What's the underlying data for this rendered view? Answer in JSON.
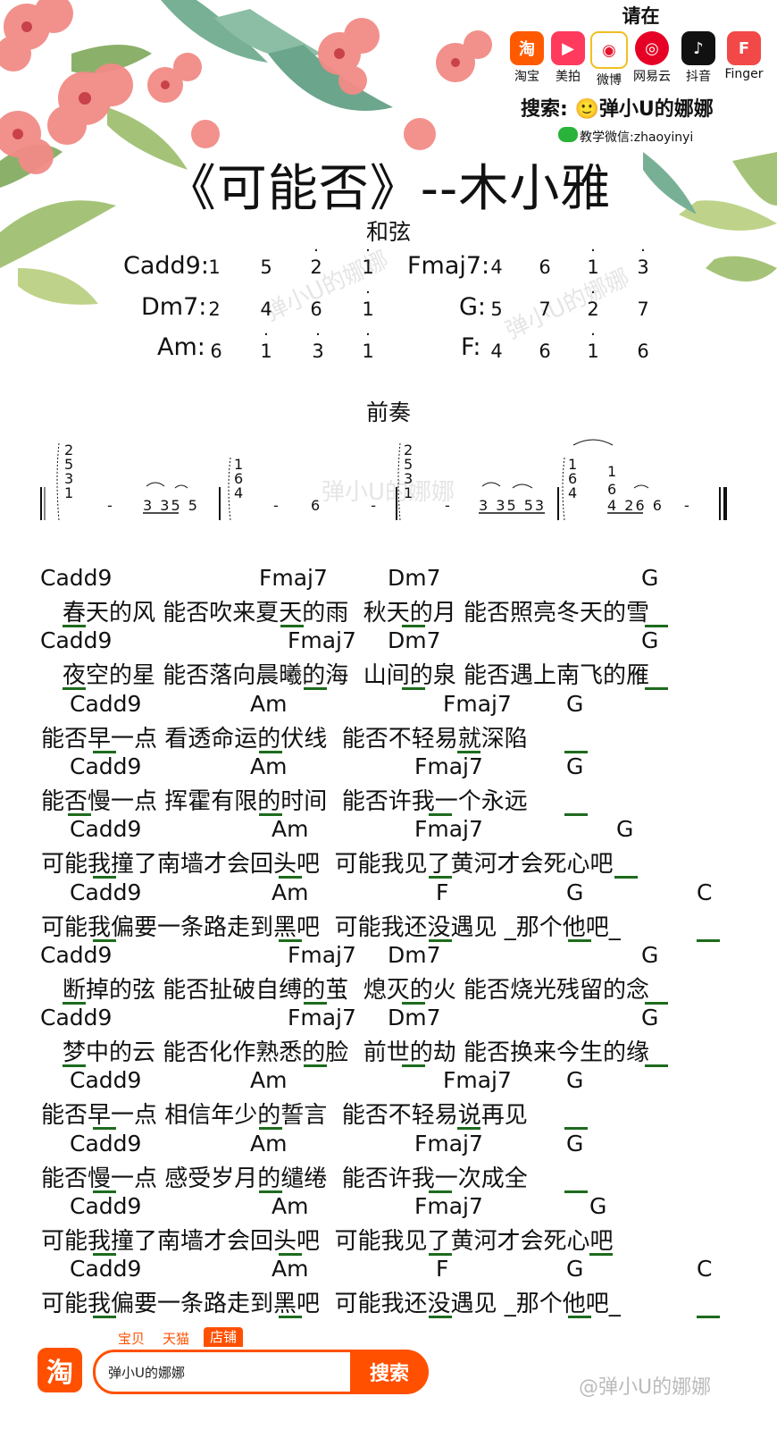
{
  "promo": {
    "title": "请在",
    "apps": [
      {
        "icon": "taobao-icon",
        "glyph": "淘",
        "color": "#ff5a00",
        "label": "淘宝"
      },
      {
        "icon": "meipai-icon",
        "glyph": "▶",
        "color": "#ff3a5c",
        "label": "美拍"
      },
      {
        "icon": "weibo-icon",
        "glyph": "◉",
        "color": "#e6162d",
        "label": "微博"
      },
      {
        "icon": "netease-music-icon",
        "glyph": "◎",
        "color": "#e60026",
        "label": "网易云"
      },
      {
        "icon": "douyin-icon",
        "glyph": "♪",
        "color": "#111111",
        "label": "抖音"
      },
      {
        "icon": "finger-icon",
        "glyph": "F",
        "color": "#f24848",
        "label": "Finger"
      }
    ],
    "search_label": "搜索: 🙂弹小U的娜娜",
    "wechat": "教学微信:zhaoyinyi"
  },
  "title": "《可能否》--木小雅",
  "chords_section_label": "和弦",
  "chord_shapes": [
    {
      "name": "Cadd9:",
      "notes": [
        "1",
        "5",
        "2",
        "1"
      ]
    },
    {
      "name": "Fmaj7:",
      "notes": [
        "4",
        "6",
        "1",
        "3"
      ]
    },
    {
      "name": "Dm7:",
      "notes": [
        "2",
        "4",
        "6",
        "1"
      ]
    },
    {
      "name": "G:",
      "notes": [
        "5",
        "7",
        "2",
        "7"
      ]
    },
    {
      "name": "Am:",
      "notes": [
        "6",
        "1",
        "3",
        "1"
      ]
    },
    {
      "name": "F:",
      "notes": [
        "4",
        "6",
        "1",
        "6"
      ]
    }
  ],
  "intro_label": "前奏",
  "intro": {
    "stack1": [
      "2",
      "5",
      "3",
      "1"
    ],
    "stack2": [
      "1",
      "6",
      "4"
    ],
    "stack3": [
      "2",
      "5",
      "3",
      "1"
    ],
    "stack4": [
      "1",
      "6",
      "4"
    ],
    "m1_rest": "-",
    "m1_notes": "3 35 5",
    "m2_rest": "-",
    "m2_notes": "6 -",
    "m3_rest": "-",
    "m3_notes": "3 35 53",
    "m4_top": "1",
    "m4_mid": "6",
    "m4_notes": "4 26 6",
    "m4_rest": "-"
  },
  "lines": [
    {
      "chords": [
        "Cadd9",
        "Fmaj7",
        "Dm7",
        "G"
      ],
      "lyric": "春天的风 能否吹来夏天的雨  秋天的月 能否照亮冬天的雪"
    },
    {
      "chords": [
        "Cadd9",
        "Fmaj7",
        "Dm7",
        "G"
      ],
      "lyric": "夜空的星 能否落向晨曦的海  山间的泉 能否遇上南飞的雁"
    },
    {
      "chords": [
        "Cadd9",
        "Am",
        "Fmaj7",
        "G"
      ],
      "lyric": "能否早一点 看透命运的伏线  能否不轻易就深陷"
    },
    {
      "chords": [
        "Cadd9",
        "Am",
        "Fmaj7",
        "G"
      ],
      "lyric": "能否慢一点 挥霍有限的时间  能否许我一个永远"
    },
    {
      "chords": [
        "Cadd9",
        "Am",
        "Fmaj7",
        "G"
      ],
      "lyric": "可能我撞了南墙才会回头吧  可能我见了黄河才会死心吧"
    },
    {
      "chords": [
        "Cadd9",
        "Am",
        "F",
        "G",
        "C"
      ],
      "lyric": "可能我偏要一条路走到黑吧  可能我还没遇见 _那个他吧_"
    },
    {
      "chords": [
        "Cadd9",
        "Fmaj7",
        "Dm7",
        "G"
      ],
      "lyric": "断掉的弦 能否扯破自缚的茧  熄灭的火 能否烧光残留的念"
    },
    {
      "chords": [
        "Cadd9",
        "Fmaj7",
        "Dm7",
        "G"
      ],
      "lyric": "梦中的云 能否化作熟悉的脸  前世的劫 能否换来今生的缘"
    },
    {
      "chords": [
        "Cadd9",
        "Am",
        "Fmaj7",
        "G"
      ],
      "lyric": "能否早一点 相信年少的誓言  能否不轻易说再见"
    },
    {
      "chords": [
        "Cadd9",
        "Am",
        "Fmaj7",
        "G"
      ],
      "lyric": "能否慢一点 感受岁月的缱绻  能否许我一次成全"
    },
    {
      "chords": [
        "Cadd9",
        "Am",
        "Fmaj7",
        "G"
      ],
      "lyric": "可能我撞了南墙才会回头吧  可能我见了黄河才会死心吧"
    },
    {
      "chords": [
        "Cadd9",
        "Am",
        "F",
        "G",
        "C"
      ],
      "lyric": "可能我偏要一条路走到黑吧  可能我还没遇见 _那个他吧_"
    }
  ],
  "watermark": "弹小U的娜娜",
  "bottom": {
    "tabs": [
      "宝贝",
      "天猫"
    ],
    "active_tab": "店铺",
    "search_value": "弹小U的娜娜",
    "search_button": "搜索",
    "weibo_watermark": "@弹小U的娜娜"
  }
}
